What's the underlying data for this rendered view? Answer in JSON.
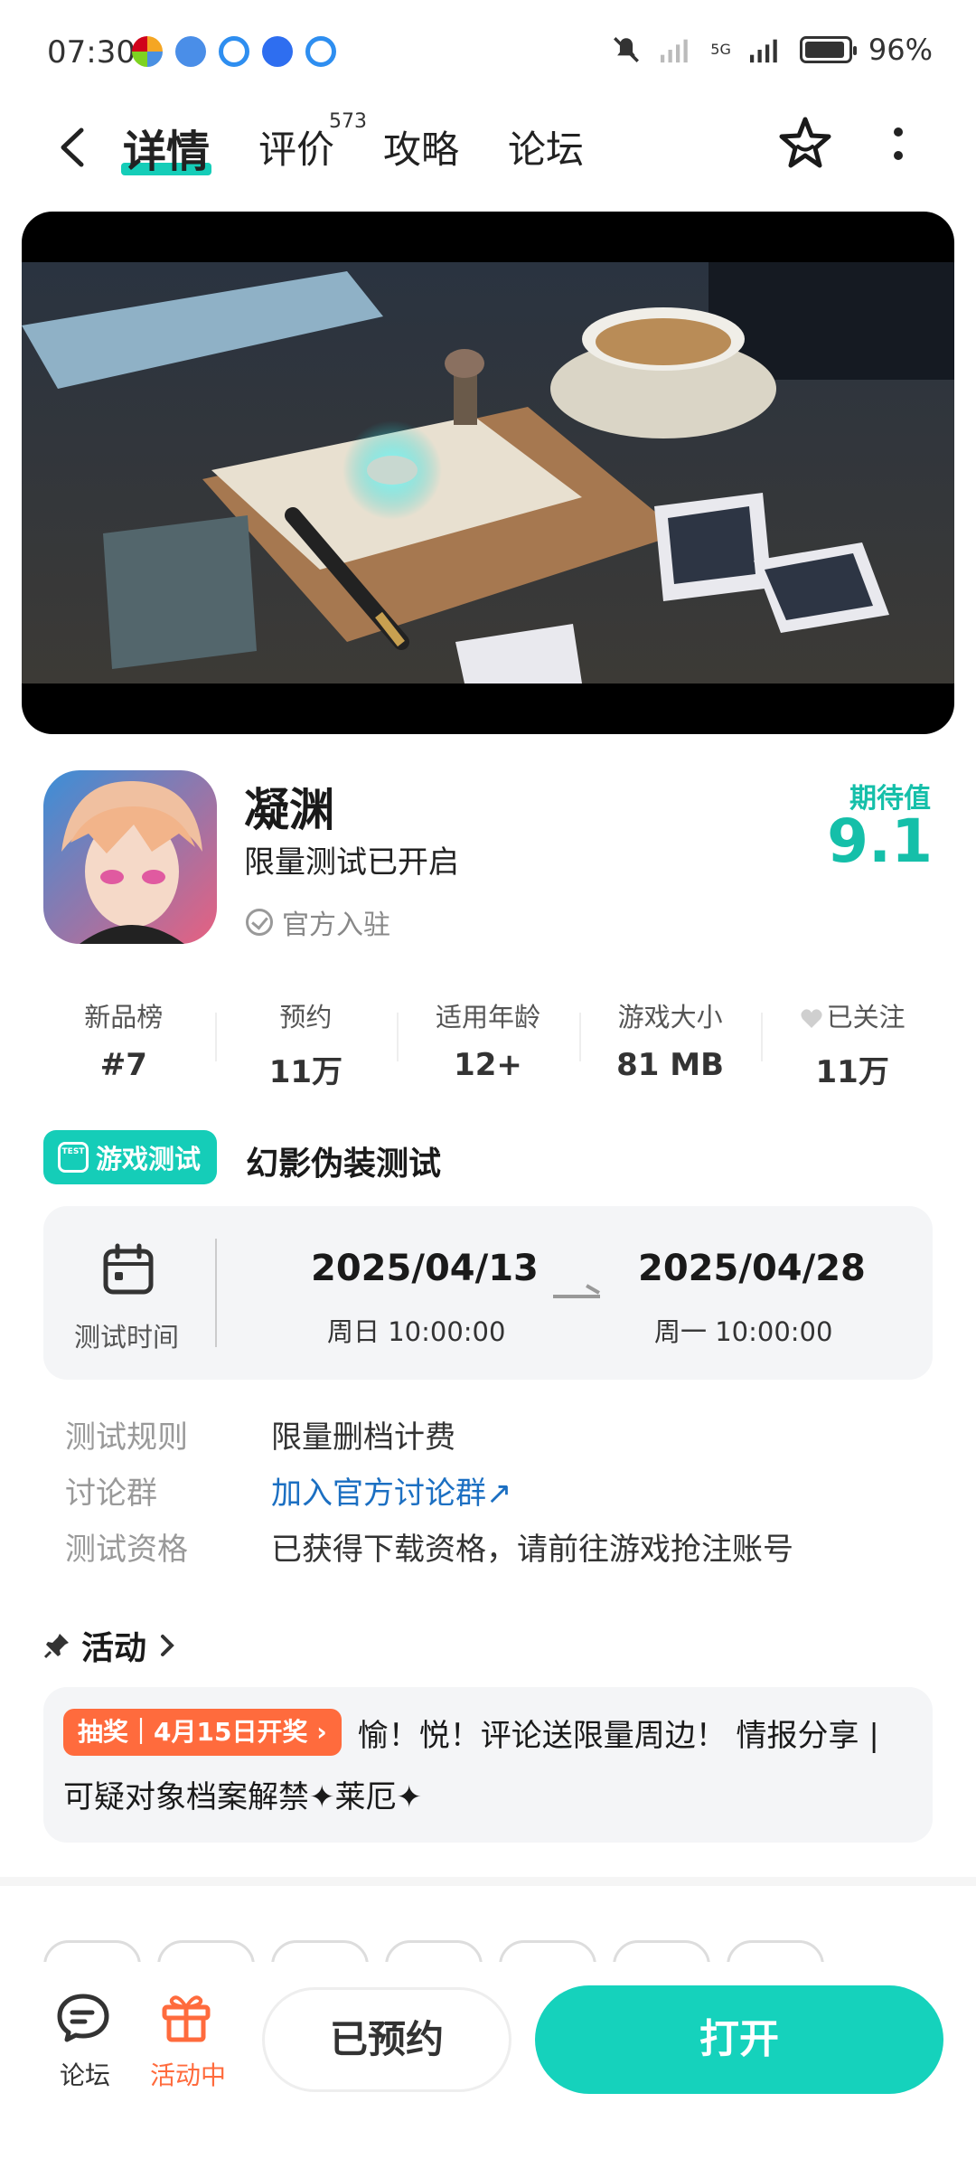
{
  "status_bar": {
    "time": "07:30",
    "battery": "96%",
    "network": "5G"
  },
  "nav": {
    "tabs": [
      {
        "label": "详情"
      },
      {
        "label": "评价"
      },
      {
        "label": "攻略"
      },
      {
        "label": "论坛"
      }
    ],
    "review_count": "573"
  },
  "app": {
    "name": "凝渊",
    "description": "限量测试已开启",
    "official": "官方入驻",
    "rating_label": "期待值",
    "rating_value": "9.1"
  },
  "stats": [
    {
      "label": "新品榜",
      "value": "#7"
    },
    {
      "label": "预约",
      "value": "11万"
    },
    {
      "label": "适用年龄",
      "value": "12+"
    },
    {
      "label": "游戏大小",
      "value": "81 MB"
    },
    {
      "label": "已关注",
      "value": "11万"
    }
  ],
  "test": {
    "badge": "游戏测试",
    "badge_icon_text": "TEST",
    "name": "幻影伪装测试",
    "time_label": "测试时间",
    "start_date": "2025/04/13",
    "start_weekday": "周日  10:00:00",
    "end_date": "2025/04/28",
    "end_weekday": "周一  10:00:00"
  },
  "details": [
    {
      "key": "测试规则",
      "value": "限量删档计费"
    },
    {
      "key": "讨论群",
      "value": "加入官方讨论群↗"
    },
    {
      "key": "测试资格",
      "value": "已获得下载资格，请前往游戏抢注账号"
    }
  ],
  "activity": {
    "title": "活动",
    "chip": "抽奖｜4月15日开奖 ›",
    "text": "愉！悦！评论送限量周边！ 情报分享 | 可疑对象档案解禁✦莱厄✦"
  },
  "bottom": {
    "forum": "论坛",
    "events": "活动中",
    "reserved": "已预约",
    "open": "打开"
  },
  "colors": {
    "accent": "#15cdb8",
    "orange": "#ff6b3d",
    "link": "#1b6fc2"
  }
}
